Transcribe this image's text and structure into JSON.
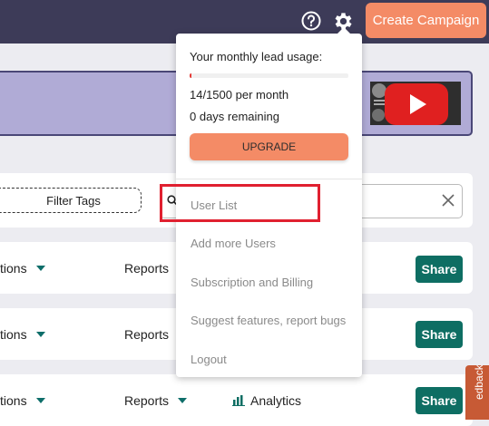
{
  "header": {
    "create_campaign_label": "Create Campaign",
    "help_icon": "question-circle-icon",
    "settings_icon": "gear-icon"
  },
  "banner": {
    "video_icon": "youtube-play-icon"
  },
  "filters": {
    "filter_tags_label": "Filter Tags",
    "search_placeholder": "",
    "clear_icon": "close-icon"
  },
  "rows": [
    {
      "options_label": "tions",
      "reports_label": "Reports",
      "share_label": "Share"
    },
    {
      "options_label": "tions",
      "reports_label": "Reports",
      "share_label": "Share"
    },
    {
      "options_label": "tions",
      "reports_label": "Reports",
      "analytics_label": "Analytics",
      "share_label": "Share"
    }
  ],
  "feedback_label": "edback",
  "dropdown": {
    "usage_title": "Your monthly lead usage:",
    "usage_fraction": 0.0093,
    "usage_count": "14/1500 per month",
    "days_remaining": "0 days remaining",
    "upgrade_label": "UPGRADE",
    "menu": [
      {
        "label": "User List"
      },
      {
        "label": "Add more Users"
      },
      {
        "label": "Subscription and Billing"
      },
      {
        "label": "Suggest features, report bugs"
      },
      {
        "label": "Logout"
      }
    ]
  },
  "colors": {
    "topbar": "#3d3b58",
    "accent_orange": "#f48b66",
    "share_green": "#0e6e63",
    "highlight_red": "#e02030"
  }
}
